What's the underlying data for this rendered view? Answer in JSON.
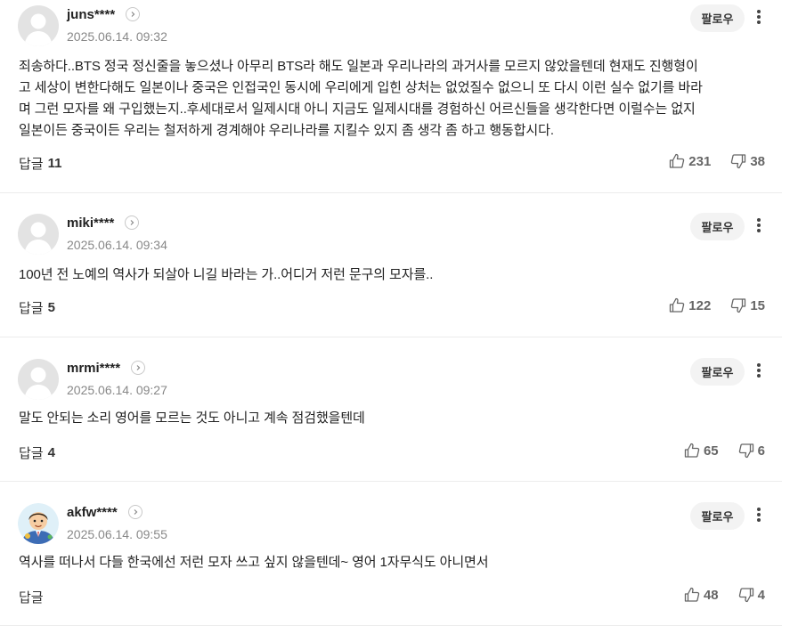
{
  "comments": [
    {
      "username": "juns****",
      "date": "2025.06.14. 09:32",
      "follow_label": "팔로우",
      "content_lines": [
        "죄송하다..BTS 정국 정신줄을 놓으셨나 아무리 BTS라 해도 일본과 우리나라의 과거사를 모르지 않았을텐데 현재도 진행형이",
        "고 세상이 변한다해도 일본이나 중국은 인접국인 동시에 우리에게 입힌 상처는 없었질수 없으니 또 다시 이런 실수 없기를 바라",
        "며 그런 모자를 왜 구입했는지..후세대로서 일제시대 아니 지금도 일제시대를 경험하신 어르신들을 생각한다면 이럴수는 없지",
        "일본이든 중국이든 우리는 철저하게 경계해야 우리나라를 지킬수 있지 좀 생각 좀 하고 행동합시다."
      ],
      "reply_label": "답글",
      "reply_count": "11",
      "likes": "231",
      "dislikes": "38"
    },
    {
      "username": "miki****",
      "date": "2025.06.14. 09:34",
      "follow_label": "팔로우",
      "content_lines": [
        "100년 전 노예의 역사가 되살아 니길 바라는 가..어디거 저런 문구의 모자를.."
      ],
      "reply_label": "답글",
      "reply_count": "5",
      "likes": "122",
      "dislikes": "15"
    },
    {
      "username": "mrmi****",
      "date": "2025.06.14. 09:27",
      "follow_label": "팔로우",
      "content_lines": [
        "말도 안되는 소리 영어를 모르는 것도 아니고 계속 점검했을텐데"
      ],
      "reply_label": "답글",
      "reply_count": "4",
      "likes": "65",
      "dislikes": "6"
    },
    {
      "username": "akfw****",
      "date": "2025.06.14. 09:55",
      "follow_label": "팔로우",
      "content_lines": [
        "역사를 떠나서 다들 한국에선 저런 모자 쓰고 싶지 않을텐데~ 영어 1자무식도 아니면서"
      ],
      "reply_label": "답글",
      "reply_count": "",
      "likes": "48",
      "dislikes": "4"
    }
  ],
  "icons": {
    "default_avatar": "default-avatar-icon",
    "custom_avatar": "cartoon-avatar-icon",
    "profile_chevron": "chevron-right-icon",
    "more": "more-vertical-icon",
    "like": "thumbs-up-icon",
    "dislike": "thumbs-down-icon"
  },
  "colors": {
    "text": "#222222",
    "meta": "#888888",
    "vote": "#666666",
    "follow_bg": "#f3f3f3",
    "divider": "#ececec"
  }
}
